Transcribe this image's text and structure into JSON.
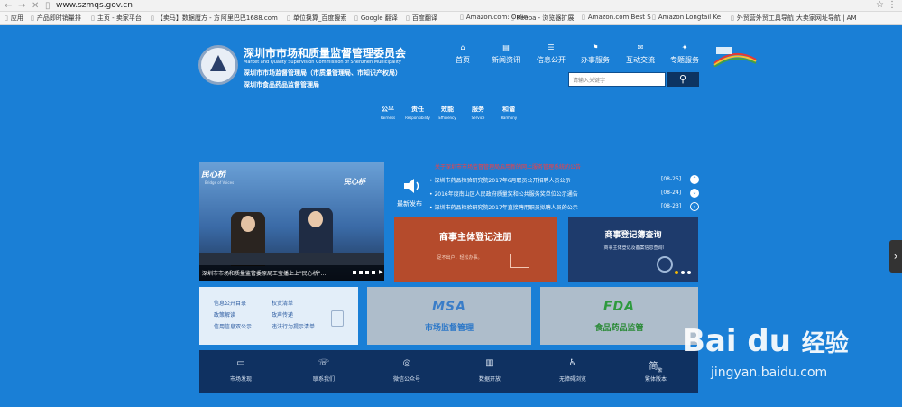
{
  "browser": {
    "url": "www.szmqs.gov.cn",
    "bookmarks": [
      "应用",
      "产品即时销量排",
      "主页 - 卖家平台",
      "【卖马】数据魔方 - 方",
      "阿里巴巴1688.com",
      "单位换算_百度搜索",
      "Google 翻译",
      "百度翻译",
      "Amazon.com: Onlin",
      "Keepa - 浏览器扩展",
      "Amazon.com Best S",
      "Amazon Longtail Ke",
      "外贸营外贸工具导航",
      "大卖家网址导航 | AM"
    ]
  },
  "header": {
    "site_title": "深圳市市场和质量监督管理委员会",
    "site_subtitle": "Market and Quality Supervision Commission of Shenzhen Municipality",
    "agency_line1": "深圳市市场监督管理局（市质量管理局、市知识产权局）",
    "agency_line2": "深圳市食品药品监督管理局",
    "nav": [
      {
        "icon": "home-icon",
        "label": "首页"
      },
      {
        "icon": "news-icon",
        "label": "新闻资讯"
      },
      {
        "icon": "info-icon",
        "label": "信息公开"
      },
      {
        "icon": "service-icon",
        "label": "办事服务"
      },
      {
        "icon": "interact-icon",
        "label": "互动交流"
      },
      {
        "icon": "special-icon",
        "label": "专题服务"
      }
    ],
    "search_placeholder": "请输入关键字",
    "values": [
      {
        "cn": "公平",
        "en": "Fairness"
      },
      {
        "cn": "责任",
        "en": "Responsibility"
      },
      {
        "cn": "效能",
        "en": "Efficiency"
      },
      {
        "cn": "服务",
        "en": "Service"
      },
      {
        "cn": "和谐",
        "en": "Harmony"
      }
    ]
  },
  "slider": {
    "badge": "民心桥",
    "badge_sub": "Bridge of Voices",
    "badge_right": "民心桥",
    "caption": "深圳市市场和质量监管委原局王宝播上上\"民心桥\"..."
  },
  "news": {
    "alert": "关于深圳市市场监督管理局启用新的网上服务管理系统的公告",
    "label": "最新发布",
    "items": [
      {
        "title": "深圳市药品检验研究院2017年6月职员公开招聘人员公示",
        "date": "[08-25]"
      },
      {
        "title": "2016年度南山区人民政府质量奖和公共服务奖单位公示通告",
        "date": "[08-24]"
      },
      {
        "title": "深圳市药品检验研究院2017年直接聘用职员拟聘人员的公示",
        "date": "[08-23]"
      }
    ]
  },
  "tiles": {
    "register_title": "商事主体登记注册",
    "register_sub": "足不出户，轻松办事。",
    "query_title": "商事登记簿查询",
    "query_sub": "（商事主体登记及备案信息查询）",
    "links": [
      "信息公开目录",
      "权责清单",
      "政策解读",
      "政声传递",
      "信用信息双公示",
      "违法行为提示清单"
    ],
    "msa_logo": "MSA",
    "msa_label": "市场监督管理",
    "fda_logo": "FDA",
    "fda_label": "食品药品监管"
  },
  "footer": [
    {
      "icon": "tv-icon",
      "label": "市场发现"
    },
    {
      "icon": "phone-icon",
      "label": "联系我们"
    },
    {
      "icon": "wechat-icon",
      "label": "微信公众号"
    },
    {
      "icon": "chart-icon",
      "label": "数据开放"
    },
    {
      "icon": "accessibility-icon",
      "label": "无障碍浏览"
    },
    {
      "icon": "traditional-icon",
      "label": "繁体版本"
    }
  ],
  "footer_glyph": "简",
  "footer_glyph_sub": "繁",
  "watermark": {
    "logo": "Bai du",
    "logo_cn": "经验",
    "sub": "jingyan.baidu.com"
  }
}
